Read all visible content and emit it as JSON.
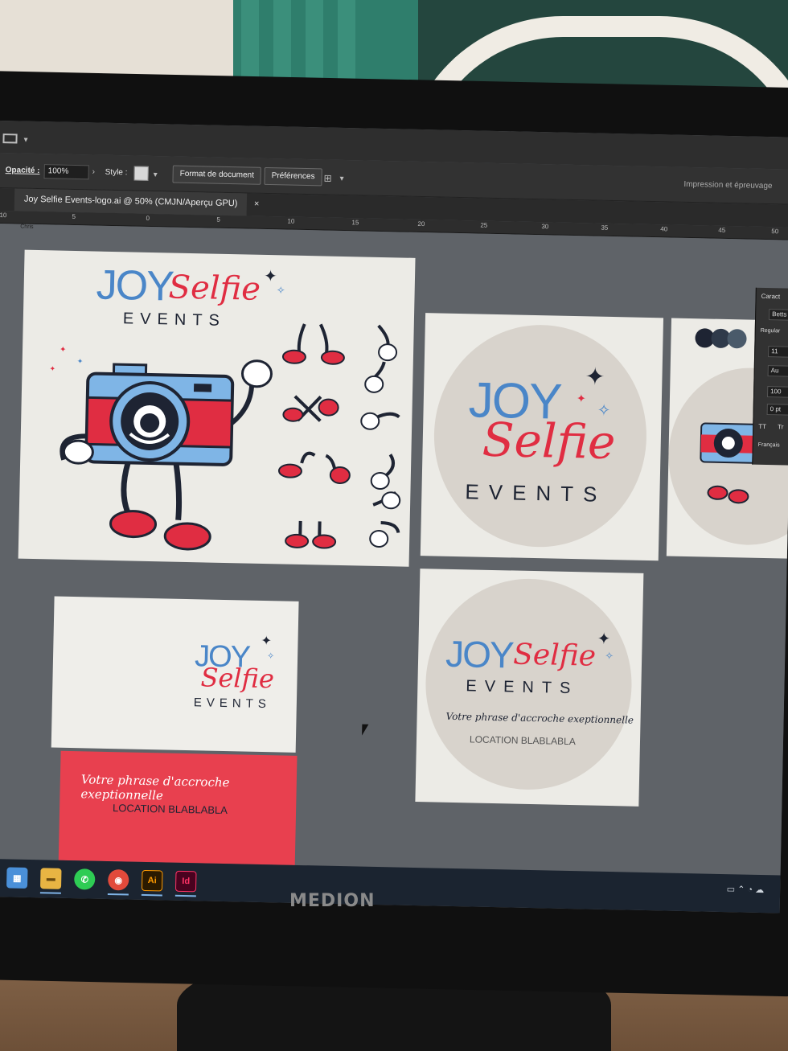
{
  "toolbar": {
    "opacity_label": "Opacité :",
    "opacity_value": "100%",
    "style_label": "Style :",
    "doc_format_button": "Format de document",
    "preferences_button": "Préférences",
    "workspace_label": "Impression et épreuvage"
  },
  "document_tab": {
    "title": "Joy Selfie Events-logo.ai @ 50% (CMJN/Aperçu GPU)",
    "close": "×"
  },
  "ruler": {
    "ticks": [
      "10",
      "5",
      "0",
      "5",
      "10",
      "15",
      "20",
      "25",
      "30",
      "35",
      "40",
      "45",
      "50"
    ],
    "sub_label": "Chris"
  },
  "logo": {
    "joy": "JOY",
    "selfie": "Selfie",
    "events": "EVENTS"
  },
  "card_texts": {
    "tagline": "Votre phrase d'accroche exeptionnelle",
    "location": "LOCATION BLABLABLA"
  },
  "character_panel": {
    "title": "Caract",
    "font_search": "Betts",
    "font_style": "Regular",
    "size_value": "11",
    "tracking_value": "Au",
    "scale_value": "100",
    "baseline_value": "0 pt",
    "tt": "TT",
    "tr": "Tr",
    "language": "Français"
  },
  "taskbar": {
    "ai_label": "Ai",
    "id_label": "Id"
  },
  "monitor": {
    "brand": "MEDION"
  },
  "colors": {
    "brand_blue": "#4a86c8",
    "brand_red": "#e02d42",
    "brand_navy": "#1e2433",
    "card_pink": "#e8404f"
  }
}
